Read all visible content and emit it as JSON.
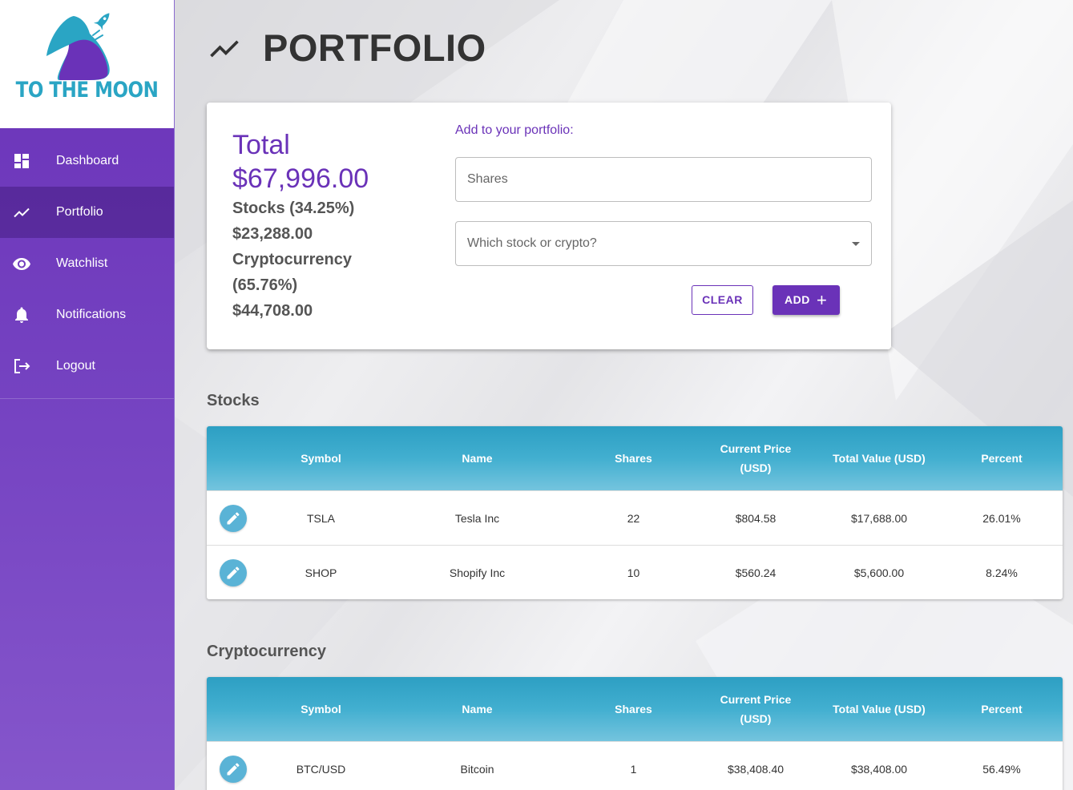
{
  "brand": {
    "name": "TO THE MOON"
  },
  "sidebar": {
    "items": [
      {
        "label": "Dashboard",
        "icon": "dashboard-icon"
      },
      {
        "label": "Portfolio",
        "icon": "trending-up-icon",
        "active": true
      },
      {
        "label": "Watchlist",
        "icon": "eye-icon"
      },
      {
        "label": "Notifications",
        "icon": "bell-icon"
      },
      {
        "label": "Logout",
        "icon": "logout-icon"
      }
    ]
  },
  "page": {
    "title": "PORTFOLIO",
    "title_icon": "trending-up-icon"
  },
  "summary": {
    "total_label": "Total",
    "total_value": "$67,996.00",
    "stocks_label": "Stocks (34.25%)",
    "stocks_value": "$23,288.00",
    "crypto_label_line1": "Cryptocurrency",
    "crypto_label_line2": "(65.76%)",
    "crypto_value": "$44,708.00"
  },
  "add_form": {
    "title": "Add to your portfolio:",
    "shares_placeholder": "Shares",
    "asset_select_placeholder": "Which stock or crypto?",
    "clear_label": "CLEAR",
    "add_label": "ADD",
    "add_icon": "plus-icon"
  },
  "columns": {
    "symbol": "Symbol",
    "name": "Name",
    "shares": "Shares",
    "price_line1": "Current Price",
    "price_line2": "(USD)",
    "total": "Total Value (USD)",
    "percent": "Percent"
  },
  "stocks": {
    "section_title": "Stocks",
    "rows": [
      {
        "symbol": "TSLA",
        "name": "Tesla Inc",
        "shares": "22",
        "price": "$804.58",
        "total": "$17,688.00",
        "percent": "26.01%"
      },
      {
        "symbol": "SHOP",
        "name": "Shopify Inc",
        "shares": "10",
        "price": "$560.24",
        "total": "$5,600.00",
        "percent": "8.24%"
      }
    ]
  },
  "crypto": {
    "section_title": "Cryptocurrency",
    "rows": [
      {
        "symbol": "BTC/USD",
        "name": "Bitcoin",
        "shares": "1",
        "price": "$38,408.40",
        "total": "$38,408.00",
        "percent": "56.49%"
      }
    ]
  },
  "colors": {
    "primary": "#6a32b8",
    "table_header": "#2d9fc3",
    "edit_button": "#5ab3d6",
    "logo_teal": "#2aa5c4"
  }
}
